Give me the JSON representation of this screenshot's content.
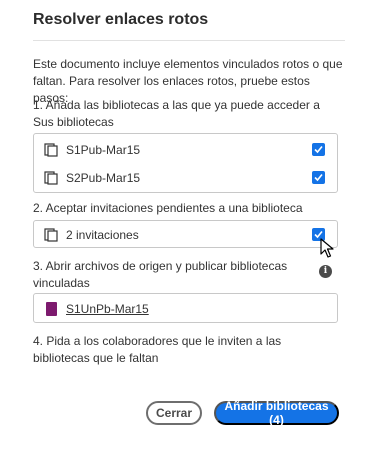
{
  "dialog": {
    "title": "Resolver enlaces rotos",
    "intro": "Este documento incluye elementos vinculados rotos o que faltan. Para resolver los enlaces rotos, pruebe estos pasos:"
  },
  "steps": {
    "step1": "1. Añada las bibliotecas a las que ya puede acceder a Sus bibliotecas",
    "step2": "2. Aceptar invitaciones pendientes a una biblioteca",
    "step3": "3. Abrir archivos de origen y publicar bibliotecas vinculadas",
    "step4": "4. Pida a los colaboradores que le inviten a las bibliotecas que le faltan"
  },
  "libraries": [
    {
      "label": "S1Pub-Mar15",
      "checked": true
    },
    {
      "label": "S2Pub-Mar15",
      "checked": true
    }
  ],
  "invitations": {
    "label": "2 invitaciones",
    "checked": true
  },
  "source_files": [
    {
      "label": "S1UnPb-Mar15"
    }
  ],
  "buttons": {
    "close": "Cerrar",
    "add": "Añadir bibliotecas (4)"
  },
  "colors": {
    "accent": "#1473e6",
    "file_icon": "#7d1a6e"
  }
}
